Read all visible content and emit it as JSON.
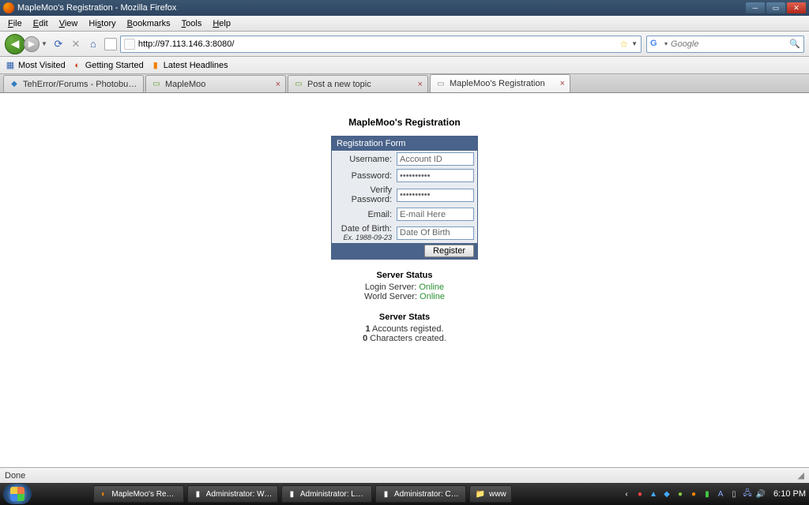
{
  "window": {
    "title": "MapleMoo's Registration - Mozilla Firefox"
  },
  "menu": {
    "items": [
      "File",
      "Edit",
      "View",
      "History",
      "Bookmarks",
      "Tools",
      "Help"
    ]
  },
  "toolbar": {
    "url": "http://97.113.146.3:8080/",
    "search_placeholder": "Google"
  },
  "bookmarks": {
    "items": [
      "Most Visited",
      "Getting Started",
      "Latest Headlines"
    ]
  },
  "tabs": [
    {
      "label": "TehError/Forums - Photobucket - V..."
    },
    {
      "label": "MapleMoo"
    },
    {
      "label": "Post a new topic"
    },
    {
      "label": "MapleMoo's Registration"
    }
  ],
  "page": {
    "title": "MapleMoo's Registration",
    "form_header": "Registration Form",
    "fields": {
      "username_lbl": "Username:",
      "username_ph": "Account ID",
      "password_lbl": "Password:",
      "password_val": "••••••••••",
      "verify_lbl": "Verify Password:",
      "verify_val": "••••••••••",
      "email_lbl": "Email:",
      "email_ph": "E-mail Here",
      "dob_lbl": "Date of Birth:",
      "dob_sub": "Ex. 1988-09-23",
      "dob_ph": "Date Of Birth"
    },
    "register_btn": "Register",
    "status_hdr": "Server Status",
    "login_server_lbl": "Login Server: ",
    "login_server_val": "Online",
    "world_server_lbl": "World Server: ",
    "world_server_val": "Online",
    "stats_hdr": "Server Stats",
    "accounts_count": "1",
    "accounts_txt": " Accounts registed.",
    "characters_count": "0",
    "characters_txt": " Characters created."
  },
  "statusbar": {
    "left": "Done"
  },
  "taskbar": {
    "items": [
      "MapleMoo's Registr...",
      "Administrator: Worl...",
      "Administrator: Logi...",
      "Administrator: Cha...",
      "www"
    ],
    "clock": "6:10 PM"
  }
}
